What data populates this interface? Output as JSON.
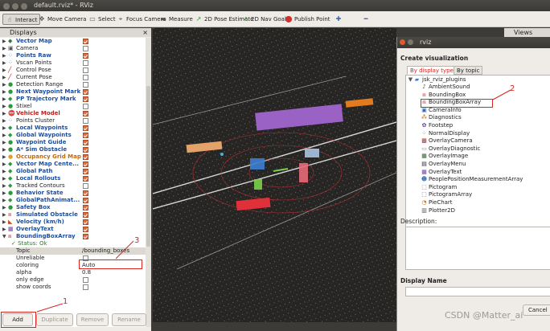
{
  "window": {
    "title": "default.rviz* - RViz"
  },
  "toolbar": [
    {
      "icon": "interact-icon",
      "glyph": "☝",
      "label": "Interact",
      "active": true
    },
    {
      "icon": "move-camera-icon",
      "glyph": "✥",
      "label": "Move Camera"
    },
    {
      "icon": "select-icon",
      "glyph": "▭",
      "label": "Select"
    },
    {
      "icon": "focus-camera-icon",
      "glyph": "⌖",
      "label": "Focus Camera"
    },
    {
      "icon": "measure-icon",
      "glyph": "▬",
      "label": "Measure"
    },
    {
      "icon": "pose-estimate-icon",
      "glyph": "↗",
      "label": "2D Pose Estimate"
    },
    {
      "icon": "nav-goal-icon",
      "glyph": "↗",
      "label": "2D Nav Goal"
    },
    {
      "icon": "publish-point-icon",
      "glyph": "⬤",
      "label": "Publish Point"
    },
    {
      "icon": "add-tool-icon",
      "glyph": "✚",
      "label": ""
    },
    {
      "icon": "remove-tool-icon",
      "glyph": "━",
      "label": ""
    }
  ],
  "displays": {
    "title": "Displays",
    "close": "×",
    "items": [
      {
        "label": "Vector Map",
        "style": "blue",
        "icon": "vector-map-icon",
        "glyph": "◆",
        "color": "#2a7a3a",
        "checked": true
      },
      {
        "label": "Camera",
        "style": "",
        "icon": "camera-icon",
        "glyph": "▣",
        "color": "#555",
        "checked": false
      },
      {
        "label": "Points Raw",
        "style": "blue",
        "icon": "points-icon",
        "glyph": "⁘",
        "color": "#3a6ab0",
        "checked": true
      },
      {
        "label": "Vscan Points",
        "style": "",
        "icon": "points-icon",
        "glyph": "⁘",
        "color": "#3a6ab0",
        "checked": false
      },
      {
        "label": "Control Pose",
        "style": "",
        "icon": "pose-icon",
        "glyph": "╱",
        "color": "#c02020",
        "checked": false
      },
      {
        "label": "Current Pose",
        "style": "",
        "icon": "pose-icon",
        "glyph": "╱",
        "color": "#c02020",
        "checked": false
      },
      {
        "label": "Detection Range",
        "style": "",
        "icon": "marker-icon",
        "glyph": "●",
        "color": "#2a9a3a",
        "checked": false
      },
      {
        "label": "Next Waypoint Mark",
        "style": "blue",
        "icon": "marker-icon",
        "glyph": "●",
        "color": "#2a9a3a",
        "checked": true
      },
      {
        "label": "PP Trajectory Mark",
        "style": "blue",
        "icon": "marker-array-icon",
        "glyph": "◆",
        "color": "#2a9a3a",
        "checked": true
      },
      {
        "label": "Stixel",
        "style": "",
        "icon": "marker-icon",
        "glyph": "●",
        "color": "#2a9a3a",
        "checked": false
      },
      {
        "label": "Vehicle Model",
        "style": "red",
        "icon": "error-icon",
        "glyph": "⛔",
        "color": "#c02020",
        "checked": true
      },
      {
        "label": "Points Cluster",
        "style": "",
        "icon": "points-icon",
        "glyph": "⁘",
        "color": "#3a6ab0",
        "checked": false
      },
      {
        "label": "Local Waypoints",
        "style": "blue",
        "icon": "marker-array-icon",
        "glyph": "◆",
        "color": "#2a9a3a",
        "checked": true
      },
      {
        "label": "Global Waypoints",
        "style": "blue",
        "icon": "marker-array-icon",
        "glyph": "◆",
        "color": "#2a9a3a",
        "checked": true
      },
      {
        "label": "Waypoint Guide",
        "style": "blue",
        "icon": "marker-icon",
        "glyph": "●",
        "color": "#2a9a3a",
        "checked": true
      },
      {
        "label": "A* Sim Obstacle",
        "style": "blue",
        "icon": "marker-icon",
        "glyph": "●",
        "color": "#2a9a3a",
        "checked": true
      },
      {
        "label": "Occupancy Grid Map",
        "style": "orange",
        "icon": "warning-icon",
        "glyph": "●",
        "color": "#e0a020",
        "checked": true
      },
      {
        "label": "Vector Map Cente...",
        "style": "blue",
        "icon": "marker-array-icon",
        "glyph": "◆",
        "color": "#2a9a3a",
        "checked": true
      },
      {
        "label": "Global Path",
        "style": "blue",
        "icon": "marker-array-icon",
        "glyph": "◆",
        "color": "#2a9a3a",
        "checked": true
      },
      {
        "label": "Local Rollouts",
        "style": "blue",
        "icon": "marker-array-icon",
        "glyph": "◆",
        "color": "#2a9a3a",
        "checked": true
      },
      {
        "label": "Tracked Contours",
        "style": "",
        "icon": "marker-array-icon",
        "glyph": "◆",
        "color": "#2a9a3a",
        "checked": false
      },
      {
        "label": "Behavior State",
        "style": "blue",
        "icon": "marker-icon",
        "glyph": "●",
        "color": "#2a9a3a",
        "checked": true
      },
      {
        "label": "GlobalPathAnimat...",
        "style": "blue",
        "icon": "marker-array-icon",
        "glyph": "◆",
        "color": "#2a9a3a",
        "checked": true
      },
      {
        "label": "Safety Box",
        "style": "blue",
        "icon": "marker-icon",
        "glyph": "●",
        "color": "#2a9a3a",
        "checked": true
      },
      {
        "label": "Simulated Obstacle",
        "style": "blue",
        "icon": "bounding-box-icon",
        "glyph": "⧈",
        "color": "#d05050",
        "checked": true
      },
      {
        "label": "Velocity (km/h)",
        "style": "blue",
        "icon": "velocity-icon",
        "glyph": "◣",
        "color": "#c05020",
        "checked": true
      },
      {
        "label": "OverlayText",
        "style": "blue",
        "icon": "overlay-text-icon",
        "glyph": "▦",
        "color": "#6a3aa0",
        "checked": true
      },
      {
        "label": "BoundingBoxArray",
        "style": "blue",
        "icon": "bounding-box-icon",
        "glyph": "⧈",
        "color": "#d05050",
        "checked": true
      }
    ],
    "props": [
      {
        "label": "✓ Status: Ok",
        "value": "",
        "icon": "status-ok-icon",
        "indent": true
      },
      {
        "label": "Topic",
        "value": "/bounding_boxes",
        "selected": true
      },
      {
        "label": "Unreliable",
        "value": "",
        "checkbox": true
      },
      {
        "label": "coloring",
        "value": "Auto"
      },
      {
        "label": "alpha",
        "value": "0.8"
      },
      {
        "label": "only edge",
        "value": "",
        "checkbox": true
      },
      {
        "label": "show coords",
        "value": "",
        "checkbox": true
      }
    ],
    "buttons": {
      "add": "Add",
      "duplicate": "Duplicate",
      "remove": "Remove",
      "rename": "Rename"
    }
  },
  "annotations": {
    "one": "1",
    "two": "2",
    "three": "3"
  },
  "views_tab": "Views",
  "dialog": {
    "title": "rviz",
    "heading": "Create visualization",
    "tabs": [
      "By display type",
      "By topic"
    ],
    "group": "jsk_rviz_plugins",
    "items": [
      {
        "label": "AmbientSound",
        "icon": "ambient-sound-icon",
        "glyph": "♪",
        "color": "#555"
      },
      {
        "label": "BoundingBox",
        "icon": "bounding-box-icon",
        "glyph": "⧈",
        "color": "#d05050"
      },
      {
        "label": "BoundingBoxArray",
        "icon": "bounding-box-icon",
        "glyph": "⧈",
        "color": "#d05050"
      },
      {
        "label": "CameraInfo",
        "icon": "camera-info-icon",
        "glyph": "▣",
        "color": "#3a6ab0"
      },
      {
        "label": "Diagnostics",
        "icon": "diagnostics-icon",
        "glyph": "⁂",
        "color": "#c06a10"
      },
      {
        "label": "Footstep",
        "icon": "footstep-icon",
        "glyph": "✿",
        "color": "#6a3aa0"
      },
      {
        "label": "NormalDisplay",
        "icon": "normal-display-icon",
        "glyph": "⁘",
        "color": "#3a6ab0"
      },
      {
        "label": "OverlayCamera",
        "icon": "overlay-camera-icon",
        "glyph": "▩",
        "color": "#b03030"
      },
      {
        "label": "OverlayDiagnostic",
        "icon": "overlay-diagnostic-icon",
        "glyph": "▭",
        "color": "#888"
      },
      {
        "label": "OverlayImage",
        "icon": "overlay-image-icon",
        "glyph": "▦",
        "color": "#2a5a2a"
      },
      {
        "label": "OverlayMenu",
        "icon": "overlay-menu-icon",
        "glyph": "▤",
        "color": "#222"
      },
      {
        "label": "OverlayText",
        "icon": "overlay-text-icon",
        "glyph": "▦",
        "color": "#6a3aa0"
      },
      {
        "label": "PeoplePositionMeasurementArray",
        "icon": "people-icon",
        "glyph": "☻",
        "color": "#3a6ab0"
      },
      {
        "label": "Pictogram",
        "icon": "pictogram-icon",
        "glyph": "⬚",
        "color": "#555"
      },
      {
        "label": "PictogramArray",
        "icon": "pictogram-icon",
        "glyph": "⬚",
        "color": "#555"
      },
      {
        "label": "PieChart",
        "icon": "pie-chart-icon",
        "glyph": "◔",
        "color": "#c06a10"
      },
      {
        "label": "Plotter2D",
        "icon": "plotter-icon",
        "glyph": "▥",
        "color": "#555"
      }
    ],
    "description_label": "Description:",
    "display_name_label": "Display Name",
    "cancel": "Cancel"
  },
  "watermark": "CSDN @Matter_ai"
}
